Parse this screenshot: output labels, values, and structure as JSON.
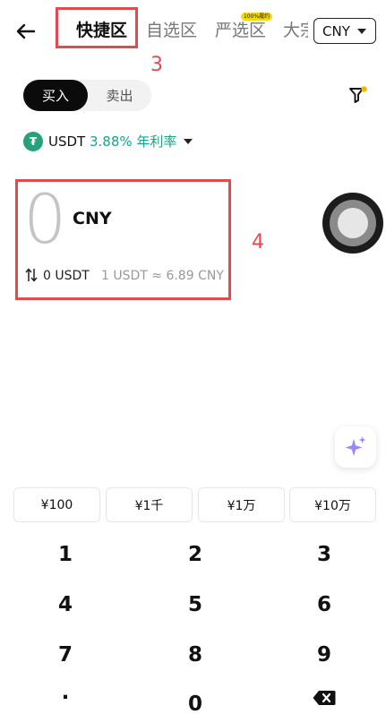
{
  "header": {
    "tabs": [
      {
        "label": "快捷区",
        "active": true
      },
      {
        "label": "自选区",
        "active": false
      },
      {
        "label": "严选区",
        "active": false,
        "badge": "100%履约"
      },
      {
        "label": "大宗",
        "active": false
      }
    ],
    "currency": "CNY"
  },
  "annotations": {
    "tab_marker": "3",
    "amount_marker": "4",
    "color": "#e5484d"
  },
  "trade_toggle": {
    "buy": "买入",
    "sell": "卖出",
    "selected": "buy"
  },
  "coin": {
    "icon": "₮",
    "name": "USDT",
    "rate": "3.88% 年利率",
    "color": "#26a17b"
  },
  "amount": {
    "value": "0",
    "currency": "CNY",
    "usdt": "0 USDT",
    "rate_text": "1 USDT ≈ 6.89 CNY"
  },
  "quick_amounts": [
    "¥100",
    "¥1千",
    "¥1万",
    "¥10万"
  ],
  "keypad": [
    [
      "1",
      "2",
      "3"
    ],
    [
      "4",
      "5",
      "6"
    ],
    [
      "7",
      "8",
      "9"
    ],
    [
      "·",
      "0",
      "⌫"
    ]
  ],
  "icons": {
    "back": "arrow-left-icon",
    "filter": "filter-icon",
    "sparkle": "sparkle-icon",
    "swap": "swap-arrows-icon",
    "backspace": "backspace-icon"
  }
}
